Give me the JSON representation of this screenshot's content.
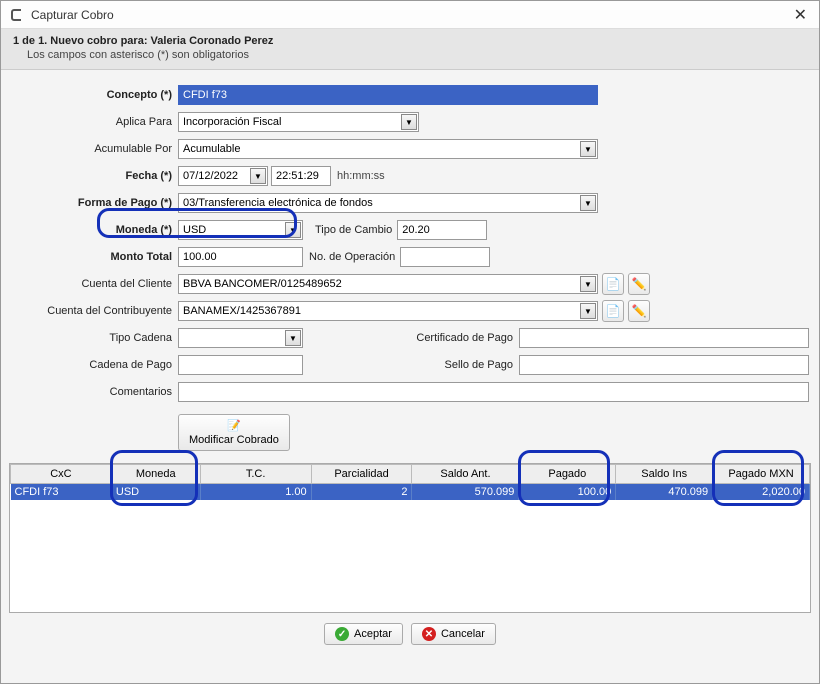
{
  "window": {
    "title": "Capturar Cobro"
  },
  "header": {
    "main": "1 de 1. Nuevo cobro para: Valeria Coronado Perez",
    "sub": "Los campos con asterisco (*) son obligatorios"
  },
  "labels": {
    "concepto": "Concepto (*)",
    "aplica": "Aplica Para",
    "acumulable": "Acumulable Por",
    "fecha": "Fecha (*)",
    "hora_hint": "hh:mm:ss",
    "forma_pago": "Forma de Pago (*)",
    "moneda": "Moneda (*)",
    "tipo_cambio": "Tipo de Cambio",
    "monto_total": "Monto Total",
    "no_operacion": "No. de Operación",
    "cuenta_cliente": "Cuenta del Cliente",
    "cuenta_contrib": "Cuenta del Contribuyente",
    "tipo_cadena": "Tipo Cadena",
    "cert_pago": "Certificado de Pago",
    "cadena_pago": "Cadena de Pago",
    "sello_pago": "Sello de Pago",
    "comentarios": "Comentarios",
    "modificar": "Modificar Cobrado"
  },
  "fields": {
    "concepto": "CFDI f73",
    "aplica": "Incorporación Fiscal",
    "acumulable": "Acumulable",
    "fecha": "07/12/2022",
    "hora": "22:51:29",
    "forma_pago": "03/Transferencia electrónica de fondos",
    "moneda": "USD",
    "tipo_cambio": "20.20",
    "monto_total": "100.00",
    "no_operacion": "",
    "cuenta_cliente": "BBVA BANCOMER/0125489652",
    "cuenta_contrib": "BANAMEX/1425367891",
    "tipo_cadena": "",
    "cert_pago": "",
    "cadena_pago": "",
    "sello_pago": "",
    "comentarios": ""
  },
  "table": {
    "headers": [
      "CxC",
      "Moneda",
      "T.C.",
      "Parcialidad",
      "Saldo Ant.",
      "Pagado",
      "Saldo Ins",
      "Pagado MXN"
    ],
    "rows": [
      {
        "cxc": "CFDI f73",
        "moneda": "USD",
        "tc": "1.00",
        "parcialidad": "2",
        "saldo_ant": "570.099",
        "pagado": "100.00",
        "saldo_ins": "470.099",
        "pagado_mxn": "2,020.00"
      }
    ]
  },
  "footer": {
    "aceptar": "Aceptar",
    "cancelar": "Cancelar"
  }
}
